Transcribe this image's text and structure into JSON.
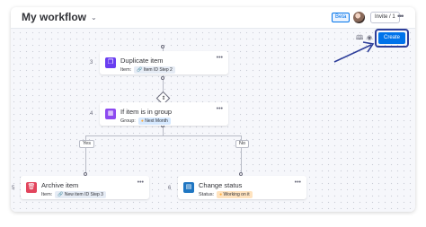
{
  "header": {
    "title": "My workflow",
    "beta_label": "Beta",
    "invite_label": "Invite / 1"
  },
  "toolbar": {
    "create_label": "Create"
  },
  "nodes": [
    {
      "step": "3",
      "name": "Duplicate item",
      "field_label": "Item:",
      "chip": "Item ID",
      "chip_step": "Step 2",
      "icon": "copy-icon",
      "color": "#6a3ef0"
    },
    {
      "step": "4",
      "name": "If item is in group",
      "field_label": "Group:",
      "chip": "Next Month",
      "icon": "condition-icon",
      "color": "#8d4af0"
    },
    {
      "step": "5",
      "name": "Archive item",
      "field_label": "Item:",
      "chip": "New item ID",
      "chip_step": "Step 3",
      "icon": "trash-icon",
      "color": "#e2445c"
    },
    {
      "step": "6",
      "name": "Change status",
      "field_label": "Status:",
      "chip": "Working on it",
      "icon": "status-icon",
      "color": "#1f76c2"
    }
  ],
  "branches": {
    "yes_label": "Yes",
    "no_label": "No"
  },
  "colors": {
    "accent": "#0073ea",
    "arrow": "#2d3e9a"
  }
}
